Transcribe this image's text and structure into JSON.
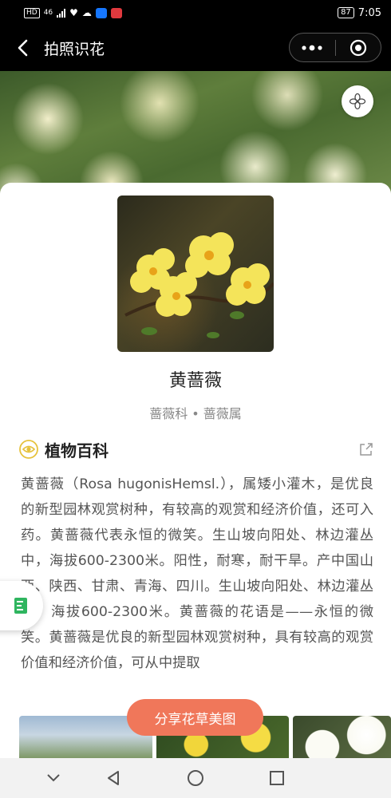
{
  "status_bar": {
    "left_chip": "HD",
    "left_small": "46",
    "battery": "87",
    "time": "7:05"
  },
  "nav": {
    "title": "拍照识花"
  },
  "plant": {
    "name": "黄蔷薇",
    "family": "蔷薇科 • 蔷薇属"
  },
  "section": {
    "title": "植物百科"
  },
  "description": "黄蔷薇（Rosa hugonisHemsl.），属矮小灌木，是优良的新型园林观赏树种，有较高的观赏和经济价值，还可入药。黄蔷薇代表永恒的微笑。生山坡向阳处、林边灌丛中，海拔600-2300米。阳性，耐寒，耐干旱。产中国山西、陕西、甘肃、青海、四川。生山坡向阳处、林边灌丛中。海拔600-2300米。黄蔷薇的花语是——永恒的微笑。黄蔷薇是优良的新型园林观赏树种，具有较高的观赏价值和经济价值，可从中提取",
  "share_button": {
    "label": "分享花草美图"
  },
  "colors": {
    "accent": "#f0775a",
    "section_icon": "#e6c23c",
    "float_icon": "#2fb55f"
  }
}
